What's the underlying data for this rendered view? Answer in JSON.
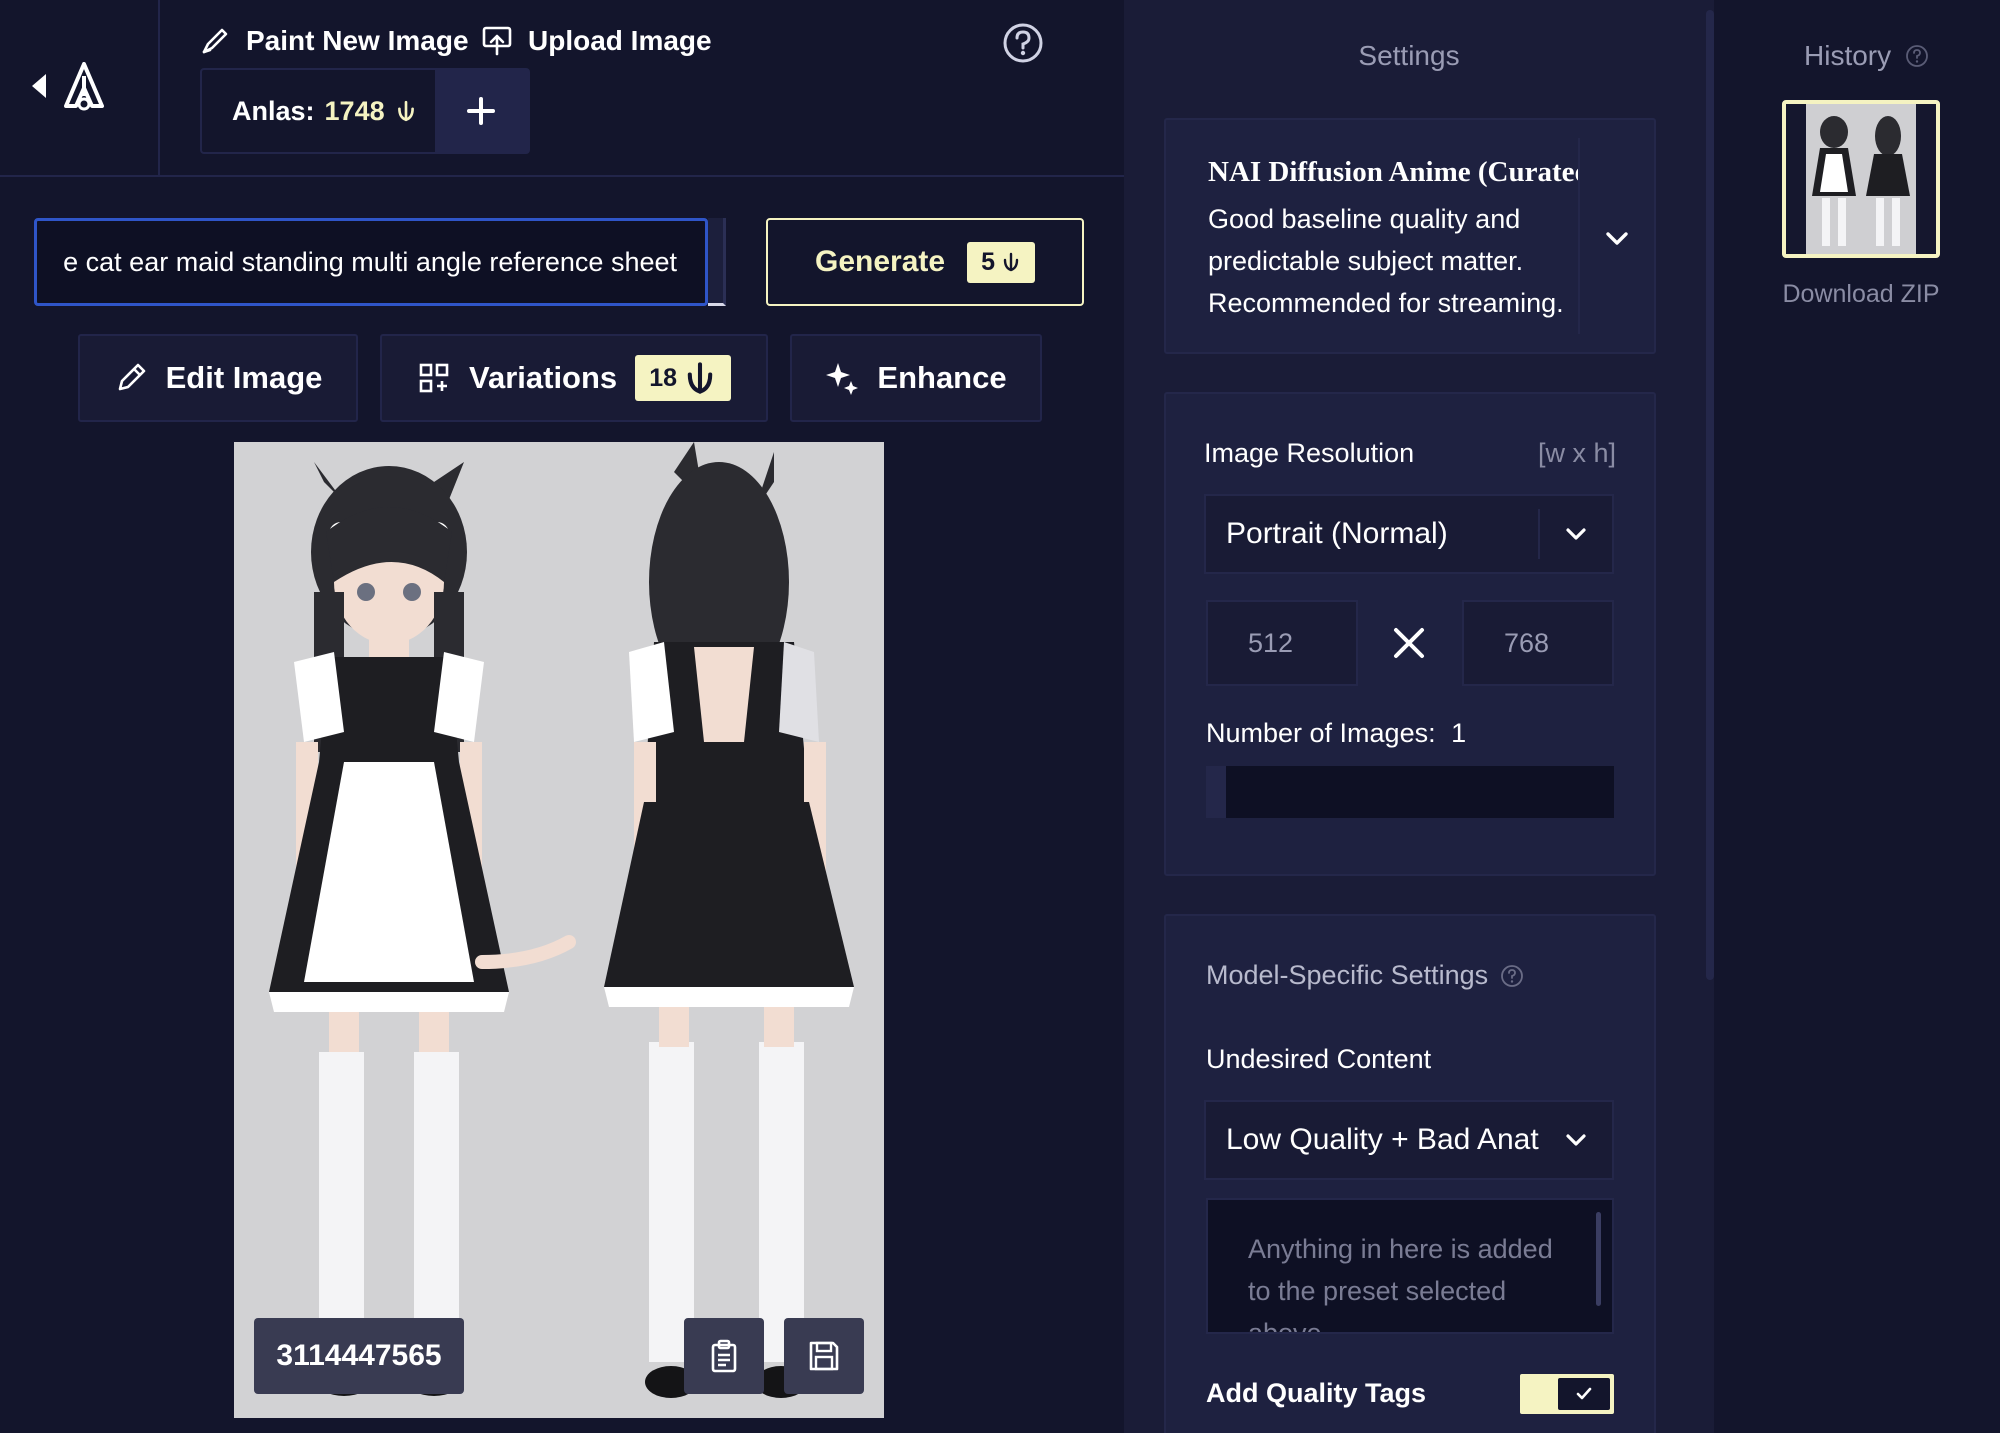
{
  "toolbar": {
    "paint_label": "Paint New Image",
    "upload_label": "Upload Image",
    "anlas_label": "Anlas:",
    "anlas_value": "1748"
  },
  "prompt": {
    "value": "e cat ear maid standing multi angle reference sheet"
  },
  "generate": {
    "label": "Generate",
    "cost": "5"
  },
  "tools": {
    "edit_label": "Edit Image",
    "variations_label": "Variations",
    "variations_cost": "18",
    "enhance_label": "Enhance"
  },
  "image": {
    "seed": "3114447565"
  },
  "settings": {
    "title": "Settings",
    "model": {
      "name": "NAI Diffusion Anime (Curated)",
      "description": "Good baseline quality and predictable subject matter. Recommended for streaming."
    },
    "resolution": {
      "label": "Image Resolution",
      "hint": "[w x h]",
      "preset": "Portrait (Normal)",
      "width": "512",
      "height": "768"
    },
    "num_images": {
      "label": "Number of Images:",
      "value": "1",
      "fraction": 0.05
    },
    "model_specific": {
      "label": "Model-Specific Settings",
      "undesired_label": "Undesired Content",
      "undesired_preset": "Low Quality + Bad Anatomy",
      "undesired_placeholder": "Anything in here is added to the preset selected above.",
      "quality_tags_label": "Add Quality Tags",
      "quality_tags_enabled": true
    }
  },
  "history": {
    "title": "History",
    "download_label": "Download ZIP"
  },
  "colors": {
    "background": "#13152c",
    "panel": "#1a1c37",
    "accent": "#f5f3c2",
    "focus": "#2f55c8"
  }
}
